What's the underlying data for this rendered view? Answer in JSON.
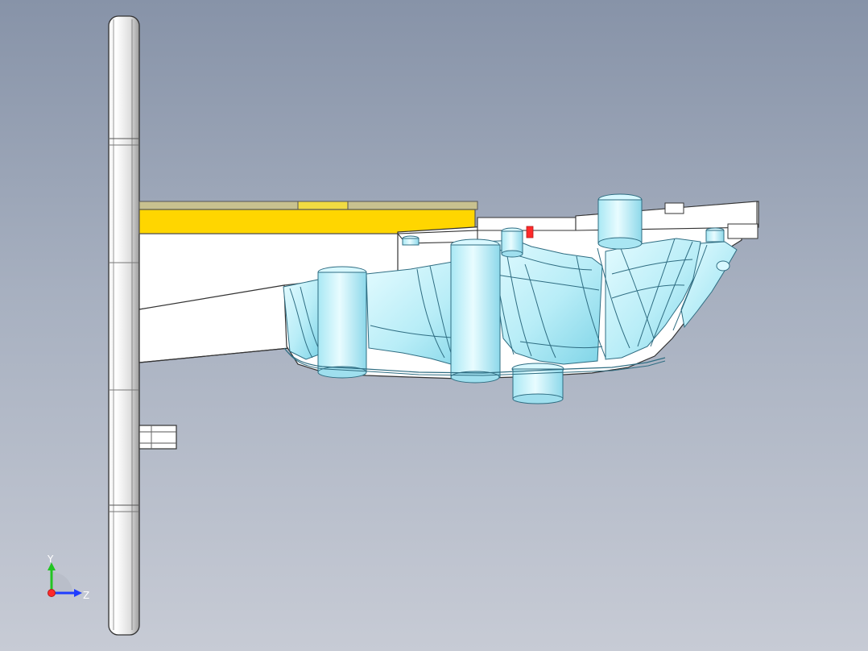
{
  "viewport": {
    "background_top": "#8793a8",
    "background_bottom": "#c7cbd5"
  },
  "model": {
    "face_color": "#ffffff",
    "highlight_color": "#ffd600",
    "cavity_color": "#b9eef7",
    "edge_color": "#4a4a4a",
    "accent_red": "#ff2a2a"
  },
  "orientation_triad": {
    "y_label": "Y",
    "z_label": "Z",
    "y_color": "#22c422",
    "z_color": "#1f3dff",
    "x_color": "#ff2a2a"
  }
}
